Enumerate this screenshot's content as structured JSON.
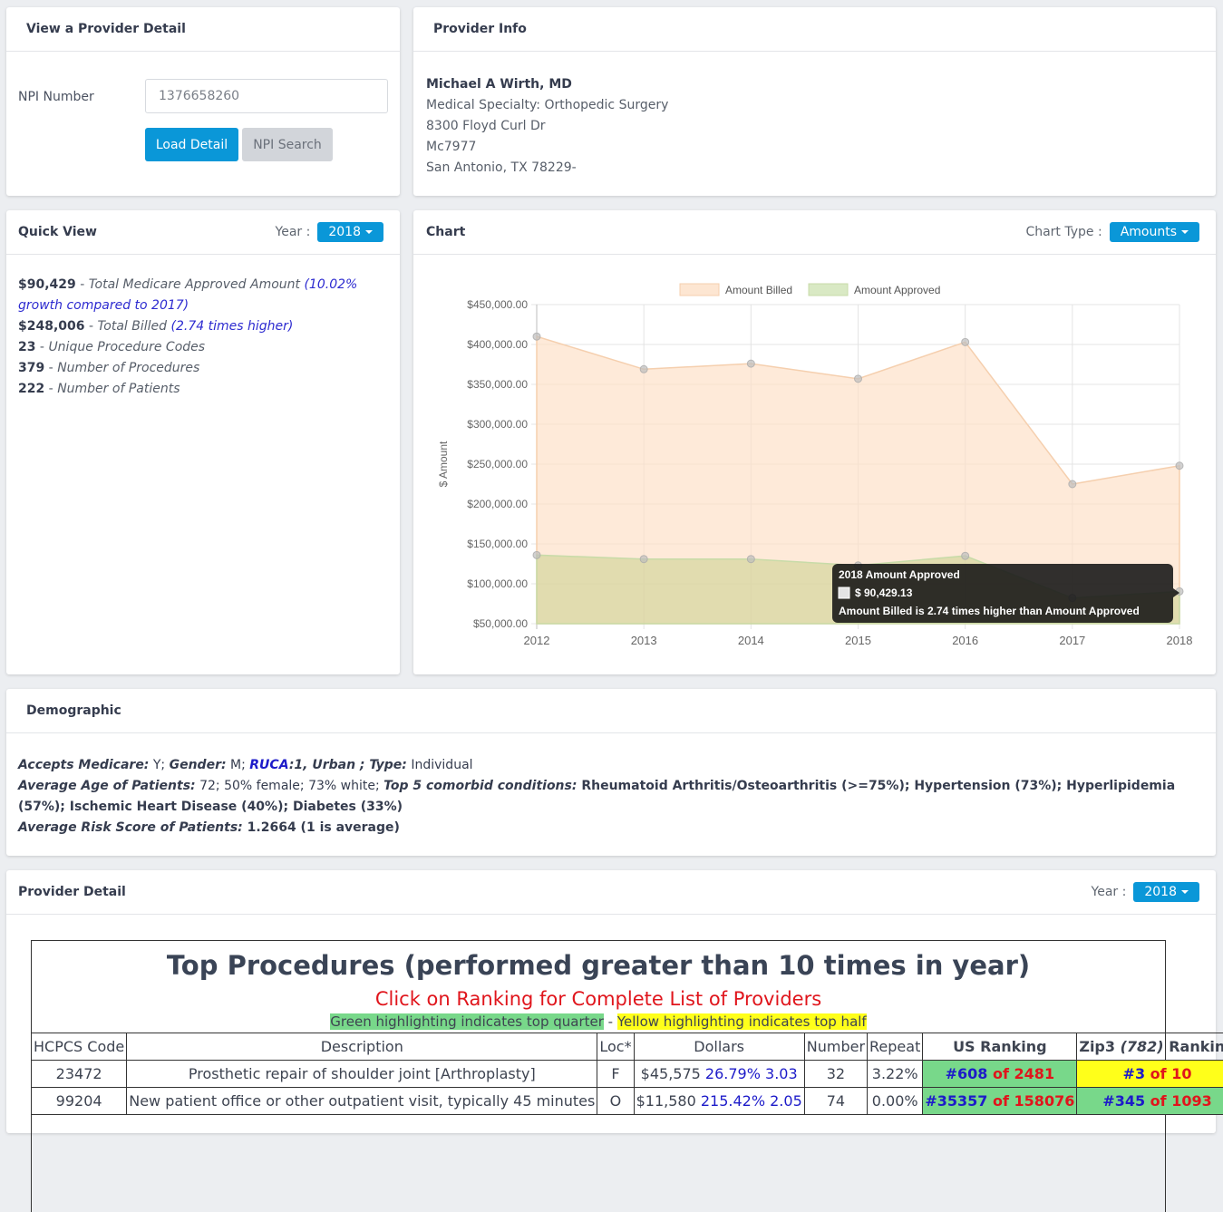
{
  "view_provider": {
    "title": "View a Provider Detail",
    "npi_label": "NPI Number",
    "npi_value": "1376658260",
    "load_button": "Load Detail",
    "npi_search_button": "NPI Search"
  },
  "provider_info": {
    "title": "Provider Info",
    "name": "Michael A Wirth, MD",
    "specialty": "Medical Specialty: Orthopedic Surgery",
    "address1": "8300 Floyd Curl Dr",
    "address2": "Mc7977",
    "city_state_zip": "San Antonio, TX 78229-"
  },
  "quick_view": {
    "title": "Quick View",
    "year_label": "Year :",
    "year_value": "2018",
    "lines": [
      {
        "value": "$90,429",
        "sep": " - ",
        "label": "Total Medicare Approved Amount",
        "note": " (10.02% growth compared to 2017)"
      },
      {
        "value": "$248,006",
        "sep": " - ",
        "label": "Total Billed",
        "note": " (2.74 times higher)"
      },
      {
        "value": "23",
        "sep": " - ",
        "label": "Unique Procedure Codes",
        "note": ""
      },
      {
        "value": "379",
        "sep": " - ",
        "label": "Number of Procedures",
        "note": ""
      },
      {
        "value": "222",
        "sep": " - ",
        "label": "Number of Patients",
        "note": ""
      }
    ]
  },
  "chart_panel": {
    "title": "Chart",
    "chart_type_label": "Chart Type :",
    "chart_type_value": "Amounts"
  },
  "chart_data": {
    "type": "area",
    "title": "",
    "xlabel": "",
    "ylabel": "$ Amount",
    "x": [
      "2012",
      "2013",
      "2014",
      "2015",
      "2016",
      "2017",
      "2018"
    ],
    "ylim": [
      50000,
      450000
    ],
    "yticks": [
      50000,
      100000,
      150000,
      200000,
      250000,
      300000,
      350000,
      400000,
      450000
    ],
    "ytick_labels": [
      "$50,000.00",
      "$100,000.00",
      "$150,000.00",
      "$200,000.00",
      "$250,000.00",
      "$300,000.00",
      "$350,000.00",
      "$400,000.00",
      "$450,000.00"
    ],
    "grid": true,
    "legend_position": "top-center",
    "series": [
      {
        "name": "Amount Billed",
        "color": "#fde6d2",
        "stroke": "#f5cfae",
        "values": [
          410000,
          369000,
          376000,
          357000,
          403000,
          225000,
          248006
        ]
      },
      {
        "name": "Amount Approved",
        "color": "#d9e9c4",
        "stroke": "#c8dba8",
        "values": [
          136000,
          131000,
          131000,
          123000,
          135000,
          82193,
          90429.13
        ]
      }
    ],
    "tooltip": {
      "title": "2018 Amount Approved",
      "value": "$ 90,429.13",
      "footer": "Amount Billed is 2.74 times higher than Amount Approved"
    }
  },
  "demographic": {
    "title": "Demographic",
    "accepts_medicare_label": "Accepts Medicare:",
    "accepts_medicare": " Y; ",
    "gender_label": "Gender:",
    "gender": " M; ",
    "ruca_label": "RUCA",
    "ruca_value": ":1, Urban",
    "type_sep": " ; ",
    "type_label": "Type:",
    "type": " Individual",
    "avg_age_label": "Average Age of Patients:",
    "avg_age": " 72; 50% female; 73% white; ",
    "comorbid_label": "Top 5 comorbid conditions:",
    "comorbid": " Rheumatoid Arthritis/Osteoarthritis (>=75%); Hypertension (73%); Hyperlipidemia (57%); Ischemic Heart Disease (40%); Diabetes (33%)",
    "risk_label": "Average Risk Score of Patients:",
    "risk_value": " 1.2664",
    "risk_note": " (1 is average)"
  },
  "provider_detail": {
    "title": "Provider Detail",
    "year_label": "Year :",
    "year_value": "2018",
    "table_title": "Top Procedures (performed greater than 10 times in year)",
    "table_subtitle": "Click on Ranking for Complete List of Providers",
    "legend_green": "Green highlighting indicates top quarter",
    "legend_sep": " - ",
    "legend_yellow": "Yellow highlighting indicates top half",
    "columns": {
      "code": "HCPCS Code",
      "desc": "Description",
      "loc": "Loc*",
      "dollars": "Dollars",
      "number": "Number",
      "repeat": "Repeat",
      "us_rank": "US Ranking",
      "zip_prefix": "Zip3 ",
      "zip_code": "(782)",
      "zip_suffix": " Ranking"
    },
    "rows": [
      {
        "code": "23472",
        "desc": "Prosthetic repair of shoulder joint [Arthroplasty]",
        "loc": "F",
        "dollars": "$45,575",
        "pct": "26.79%",
        "ratio": "3.03",
        "number": "32",
        "repeat": "3.22%",
        "us_rank": "#608",
        "us_of": "of 2481",
        "us_hl": "green",
        "zip_rank": "#3",
        "zip_of": "of 10",
        "zip_hl": "yellow"
      },
      {
        "code": "99204",
        "desc": "New patient office or other outpatient visit, typically 45 minutes",
        "loc": "O",
        "dollars": "$11,580",
        "pct": "215.42%",
        "ratio": "2.05",
        "number": "74",
        "repeat": "0.00%",
        "us_rank": "#35357",
        "us_of": "of 158076",
        "us_hl": "green",
        "zip_rank": "#345",
        "zip_of": "of 1093",
        "zip_hl": "green"
      }
    ]
  }
}
